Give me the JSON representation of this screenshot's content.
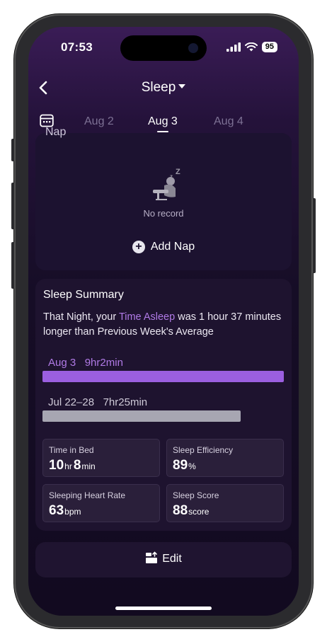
{
  "status": {
    "time": "07:53",
    "battery": "95"
  },
  "nav": {
    "title": "Sleep"
  },
  "dates": {
    "prev": "Aug 2",
    "current": "Aug 3",
    "next": "Aug 4"
  },
  "nap": {
    "label": "Nap",
    "empty_text": "No record",
    "add_label": "Add Nap"
  },
  "summary": {
    "title": "Sleep Summary",
    "sentence": {
      "part1": "That Night, your ",
      "highlight": "Time Asleep",
      "part2": " was 1  hour  37 minutes  longer than Previous Week's Average"
    },
    "current": {
      "label": "Aug 3",
      "value": "9hr2min",
      "fraction": 1.0,
      "color": "#9b5fe0"
    },
    "previous": {
      "label": "Jul 22–28",
      "value": "7hr25min",
      "fraction": 0.82,
      "color": "#a7a6b2"
    },
    "stats": {
      "time_in_bed": {
        "label": "Time in Bed",
        "hr": "10",
        "hr_unit": "hr",
        "min": "8",
        "min_unit": "min"
      },
      "efficiency": {
        "label": "Sleep Efficiency",
        "value": "89",
        "unit": "%"
      },
      "heart_rate": {
        "label": "Sleeping Heart Rate",
        "value": "63",
        "unit": "bpm"
      },
      "score": {
        "label": "Sleep Score",
        "value": "88",
        "unit": "score"
      }
    }
  },
  "edit": {
    "label": "Edit"
  }
}
